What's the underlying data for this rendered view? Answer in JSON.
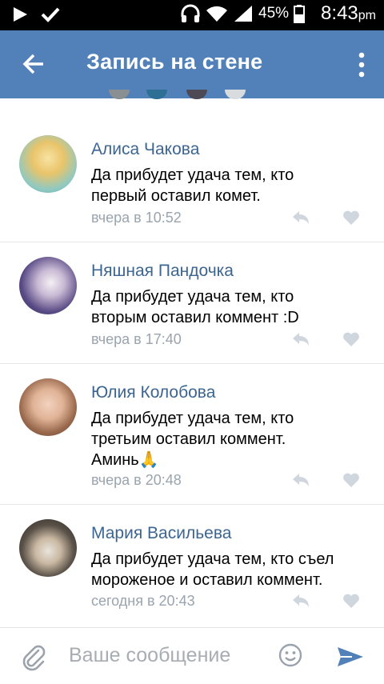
{
  "status_bar": {
    "battery_percent": "45%",
    "time": "8:43",
    "ampm": "pm"
  },
  "toolbar": {
    "title": "Запись на стене"
  },
  "comments": [
    {
      "author": "Алиса Чакова",
      "text_line1": "Да прибудет удача тем, кто",
      "text_line2": "первый оставил комет.",
      "date": "вчера в 10:52"
    },
    {
      "author": "Няшная Пандочка",
      "text_line1": "Да прибудет удача тем, кто",
      "text_line2": "вторым оставил коммент :D",
      "date": "вчера в 17:40"
    },
    {
      "author": "Юлия Колобова",
      "text_line1": "Да прибудет удача тем, кто",
      "text_line2": "третьим оставил коммент.",
      "text_line3": "Аминь🙏",
      "date": "вчера в 20:48"
    },
    {
      "author": "Мария Васильева",
      "text_line1": "Да прибудет удача тем, кто съел",
      "text_line2": "мороженое и оставил коммент.",
      "date": "сегодня в 20:43"
    }
  ],
  "composer": {
    "placeholder": "Ваше сообщение"
  },
  "colors": {
    "toolbar": "#5181b8",
    "author_name": "#3c6592",
    "date": "#9aa4af",
    "send": "#5181b8"
  }
}
